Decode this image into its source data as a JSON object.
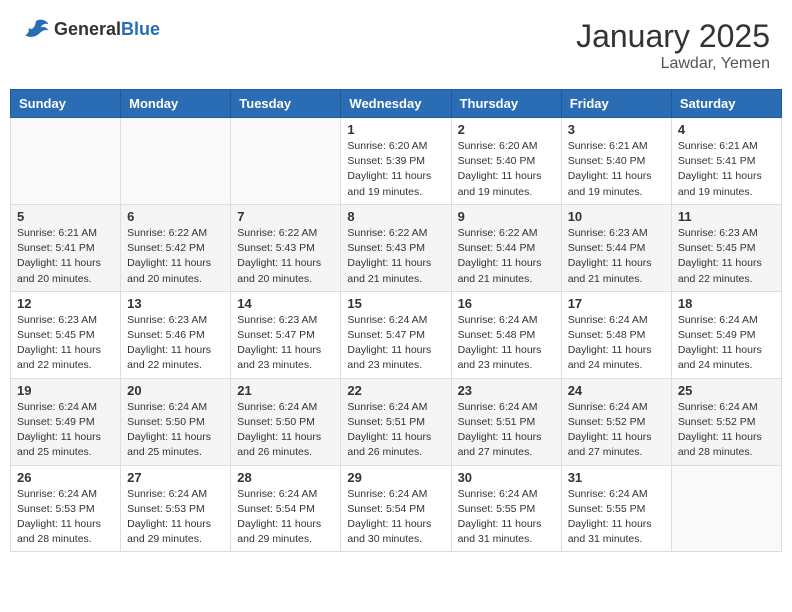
{
  "header": {
    "logo_general": "General",
    "logo_blue": "Blue",
    "title": "January 2025",
    "location": "Lawdar, Yemen"
  },
  "weekdays": [
    "Sunday",
    "Monday",
    "Tuesday",
    "Wednesday",
    "Thursday",
    "Friday",
    "Saturday"
  ],
  "weeks": [
    [
      {
        "day": "",
        "info": ""
      },
      {
        "day": "",
        "info": ""
      },
      {
        "day": "",
        "info": ""
      },
      {
        "day": "1",
        "info": "Sunrise: 6:20 AM\nSunset: 5:39 PM\nDaylight: 11 hours and 19 minutes."
      },
      {
        "day": "2",
        "info": "Sunrise: 6:20 AM\nSunset: 5:40 PM\nDaylight: 11 hours and 19 minutes."
      },
      {
        "day": "3",
        "info": "Sunrise: 6:21 AM\nSunset: 5:40 PM\nDaylight: 11 hours and 19 minutes."
      },
      {
        "day": "4",
        "info": "Sunrise: 6:21 AM\nSunset: 5:41 PM\nDaylight: 11 hours and 19 minutes."
      }
    ],
    [
      {
        "day": "5",
        "info": "Sunrise: 6:21 AM\nSunset: 5:41 PM\nDaylight: 11 hours and 20 minutes."
      },
      {
        "day": "6",
        "info": "Sunrise: 6:22 AM\nSunset: 5:42 PM\nDaylight: 11 hours and 20 minutes."
      },
      {
        "day": "7",
        "info": "Sunrise: 6:22 AM\nSunset: 5:43 PM\nDaylight: 11 hours and 20 minutes."
      },
      {
        "day": "8",
        "info": "Sunrise: 6:22 AM\nSunset: 5:43 PM\nDaylight: 11 hours and 21 minutes."
      },
      {
        "day": "9",
        "info": "Sunrise: 6:22 AM\nSunset: 5:44 PM\nDaylight: 11 hours and 21 minutes."
      },
      {
        "day": "10",
        "info": "Sunrise: 6:23 AM\nSunset: 5:44 PM\nDaylight: 11 hours and 21 minutes."
      },
      {
        "day": "11",
        "info": "Sunrise: 6:23 AM\nSunset: 5:45 PM\nDaylight: 11 hours and 22 minutes."
      }
    ],
    [
      {
        "day": "12",
        "info": "Sunrise: 6:23 AM\nSunset: 5:45 PM\nDaylight: 11 hours and 22 minutes."
      },
      {
        "day": "13",
        "info": "Sunrise: 6:23 AM\nSunset: 5:46 PM\nDaylight: 11 hours and 22 minutes."
      },
      {
        "day": "14",
        "info": "Sunrise: 6:23 AM\nSunset: 5:47 PM\nDaylight: 11 hours and 23 minutes."
      },
      {
        "day": "15",
        "info": "Sunrise: 6:24 AM\nSunset: 5:47 PM\nDaylight: 11 hours and 23 minutes."
      },
      {
        "day": "16",
        "info": "Sunrise: 6:24 AM\nSunset: 5:48 PM\nDaylight: 11 hours and 23 minutes."
      },
      {
        "day": "17",
        "info": "Sunrise: 6:24 AM\nSunset: 5:48 PM\nDaylight: 11 hours and 24 minutes."
      },
      {
        "day": "18",
        "info": "Sunrise: 6:24 AM\nSunset: 5:49 PM\nDaylight: 11 hours and 24 minutes."
      }
    ],
    [
      {
        "day": "19",
        "info": "Sunrise: 6:24 AM\nSunset: 5:49 PM\nDaylight: 11 hours and 25 minutes."
      },
      {
        "day": "20",
        "info": "Sunrise: 6:24 AM\nSunset: 5:50 PM\nDaylight: 11 hours and 25 minutes."
      },
      {
        "day": "21",
        "info": "Sunrise: 6:24 AM\nSunset: 5:50 PM\nDaylight: 11 hours and 26 minutes."
      },
      {
        "day": "22",
        "info": "Sunrise: 6:24 AM\nSunset: 5:51 PM\nDaylight: 11 hours and 26 minutes."
      },
      {
        "day": "23",
        "info": "Sunrise: 6:24 AM\nSunset: 5:51 PM\nDaylight: 11 hours and 27 minutes."
      },
      {
        "day": "24",
        "info": "Sunrise: 6:24 AM\nSunset: 5:52 PM\nDaylight: 11 hours and 27 minutes."
      },
      {
        "day": "25",
        "info": "Sunrise: 6:24 AM\nSunset: 5:52 PM\nDaylight: 11 hours and 28 minutes."
      }
    ],
    [
      {
        "day": "26",
        "info": "Sunrise: 6:24 AM\nSunset: 5:53 PM\nDaylight: 11 hours and 28 minutes."
      },
      {
        "day": "27",
        "info": "Sunrise: 6:24 AM\nSunset: 5:53 PM\nDaylight: 11 hours and 29 minutes."
      },
      {
        "day": "28",
        "info": "Sunrise: 6:24 AM\nSunset: 5:54 PM\nDaylight: 11 hours and 29 minutes."
      },
      {
        "day": "29",
        "info": "Sunrise: 6:24 AM\nSunset: 5:54 PM\nDaylight: 11 hours and 30 minutes."
      },
      {
        "day": "30",
        "info": "Sunrise: 6:24 AM\nSunset: 5:55 PM\nDaylight: 11 hours and 31 minutes."
      },
      {
        "day": "31",
        "info": "Sunrise: 6:24 AM\nSunset: 5:55 PM\nDaylight: 11 hours and 31 minutes."
      },
      {
        "day": "",
        "info": ""
      }
    ]
  ]
}
